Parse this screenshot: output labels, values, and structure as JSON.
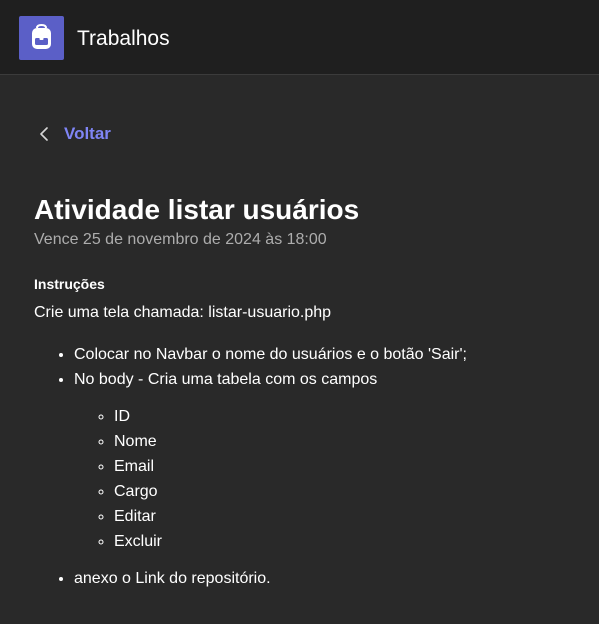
{
  "app": {
    "title": "Trabalhos",
    "icon": "backpack-icon",
    "accent": "#5b5fc7"
  },
  "nav": {
    "back_label": "Voltar",
    "back_color": "#7f85f5"
  },
  "assignment": {
    "title": "Atividade listar usuários",
    "due": "Vence 25 de novembro de 2024 às 18:00",
    "instructions_heading": "Instruções",
    "intro": "Crie uma tela chamada: listar-usuario.php",
    "items": [
      "Colocar no Navbar o nome do usuários e o botão 'Sair';",
      "No body - Cria uma tabela com os campos",
      "anexo o Link do repositório."
    ],
    "fields": [
      "ID",
      "Nome",
      "Email",
      "Cargo",
      "Editar",
      "Excluir"
    ]
  }
}
